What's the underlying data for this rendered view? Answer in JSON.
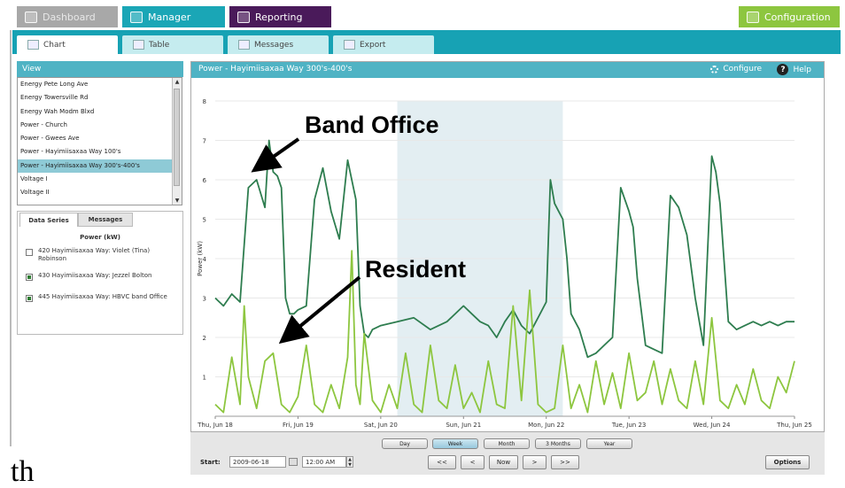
{
  "top_tabs": [
    {
      "label": "Dashboard",
      "icon": "dashboard-icon"
    },
    {
      "label": "Manager",
      "icon": "manager-icon"
    },
    {
      "label": "Reporting",
      "icon": "reporting-icon"
    },
    {
      "label": "Configuration",
      "icon": "configuration-icon"
    }
  ],
  "sub_tabs": [
    {
      "label": "Chart",
      "icon": "chart-icon",
      "active": true
    },
    {
      "label": "Table",
      "icon": "table-icon",
      "active": false
    },
    {
      "label": "Messages",
      "icon": "messages-icon",
      "active": false
    },
    {
      "label": "Export",
      "icon": "export-icon",
      "active": false
    }
  ],
  "view": {
    "header": "View",
    "items": [
      "Energy Pete Long Ave",
      "Energy Towersville Rd",
      "Energy Wah Modm Blxd",
      "Power - Church",
      "Power - Gwees Ave",
      "Power - Hayimiisaxaa Way 100's",
      "Power - Hayimiisaxaa Way 300's-400's",
      "Voltage I",
      "Voltage II"
    ],
    "selected_index": 6
  },
  "data_series_panel": {
    "tabs": [
      "Data Series",
      "Messages"
    ],
    "title": "Power (kW)",
    "series": [
      {
        "label": "420 Hayimiisaxaa Way: Violet (Tina) Robinson",
        "checked": false
      },
      {
        "label": "430 Hayimiisaxaa Way: Jezzel Bolton",
        "checked": true
      },
      {
        "label": "445 Hayimiisaxaa Way: HBVC band Office",
        "checked": true
      }
    ]
  },
  "chart_panel": {
    "title": "Power - Hayimiisaxaa Way 300's-400's",
    "configure_label": "Configure",
    "help_label": "Help"
  },
  "chart_data": {
    "type": "line",
    "ylabel": "Power (kW)",
    "ylim": [
      0,
      8
    ],
    "yticks": [
      1,
      2,
      3,
      4,
      5,
      6,
      7,
      8
    ],
    "xlim": [
      0,
      7
    ],
    "xticks": [
      {
        "x": 0,
        "label": "Thu, Jun 18"
      },
      {
        "x": 1,
        "label": "Fri, Jun 19"
      },
      {
        "x": 2,
        "label": "Sat, Jun 20"
      },
      {
        "x": 3,
        "label": "Sun, Jun 21"
      },
      {
        "x": 4,
        "label": "Mon, Jun 22"
      },
      {
        "x": 5,
        "label": "Tue, Jun 23"
      },
      {
        "x": 6,
        "label": "Wed, Jun 24"
      },
      {
        "x": 7,
        "label": "Thu, Jun 25"
      }
    ],
    "shaded_region": [
      2.2,
      4.2
    ],
    "grid": true,
    "series": [
      {
        "color": "#2e7d4f",
        "x": [
          0,
          0.1,
          0.2,
          0.3,
          0.4,
          0.5,
          0.6,
          0.65,
          0.7,
          0.75,
          0.8,
          0.85,
          0.9,
          0.95,
          1.0,
          1.1,
          1.2,
          1.3,
          1.4,
          1.5,
          1.6,
          1.7,
          1.75,
          1.8,
          1.85,
          1.9,
          2.0,
          2.2,
          2.4,
          2.6,
          2.8,
          3.0,
          3.1,
          3.2,
          3.3,
          3.4,
          3.5,
          3.6,
          3.7,
          3.8,
          3.9,
          4.0,
          4.05,
          4.1,
          4.15,
          4.2,
          4.25,
          4.3,
          4.4,
          4.5,
          4.6,
          4.7,
          4.8,
          4.9,
          5.0,
          5.05,
          5.1,
          5.2,
          5.3,
          5.4,
          5.5,
          5.6,
          5.7,
          5.8,
          5.9,
          6.0,
          6.05,
          6.1,
          6.2,
          6.3,
          6.4,
          6.5,
          6.6,
          6.7,
          6.8,
          6.9,
          7.0
        ],
        "values": [
          3.0,
          2.8,
          3.1,
          2.9,
          5.8,
          6.0,
          5.3,
          7.0,
          6.2,
          6.1,
          5.8,
          3.0,
          2.6,
          2.6,
          2.7,
          2.8,
          5.5,
          6.3,
          5.2,
          4.5,
          6.5,
          5.5,
          2.8,
          2.1,
          2.0,
          2.2,
          2.3,
          2.4,
          2.5,
          2.2,
          2.4,
          2.8,
          2.6,
          2.4,
          2.3,
          2.0,
          2.4,
          2.7,
          2.3,
          2.1,
          2.5,
          2.9,
          6.0,
          5.4,
          5.2,
          5.0,
          4.0,
          2.6,
          2.2,
          1.5,
          1.6,
          1.8,
          2.0,
          5.8,
          5.2,
          4.8,
          3.5,
          1.8,
          1.7,
          1.6,
          5.6,
          5.3,
          4.6,
          3.0,
          1.8,
          6.6,
          6.2,
          5.4,
          2.4,
          2.2,
          2.3,
          2.4,
          2.3,
          2.4,
          2.3,
          2.4,
          2.4
        ]
      },
      {
        "color": "#8dc63f",
        "x": [
          0,
          0.1,
          0.2,
          0.3,
          0.35,
          0.4,
          0.5,
          0.6,
          0.7,
          0.8,
          0.9,
          1.0,
          1.1,
          1.2,
          1.3,
          1.4,
          1.5,
          1.6,
          1.65,
          1.7,
          1.75,
          1.8,
          1.9,
          2.0,
          2.1,
          2.2,
          2.3,
          2.4,
          2.5,
          2.6,
          2.7,
          2.8,
          2.9,
          3.0,
          3.1,
          3.2,
          3.3,
          3.4,
          3.5,
          3.6,
          3.7,
          3.8,
          3.9,
          4.0,
          4.1,
          4.2,
          4.3,
          4.4,
          4.5,
          4.6,
          4.7,
          4.8,
          4.9,
          5.0,
          5.1,
          5.2,
          5.3,
          5.4,
          5.5,
          5.6,
          5.7,
          5.8,
          5.9,
          6.0,
          6.1,
          6.2,
          6.3,
          6.4,
          6.5,
          6.6,
          6.7,
          6.8,
          6.9,
          7.0
        ],
        "values": [
          0.3,
          0.1,
          1.5,
          0.3,
          2.8,
          1.0,
          0.2,
          1.4,
          1.6,
          0.3,
          0.1,
          0.5,
          1.8,
          0.3,
          0.1,
          0.8,
          0.2,
          1.5,
          4.2,
          0.8,
          0.3,
          2.1,
          0.4,
          0.1,
          0.8,
          0.2,
          1.6,
          0.3,
          0.1,
          1.8,
          0.4,
          0.2,
          1.3,
          0.2,
          0.6,
          0.1,
          1.4,
          0.3,
          0.2,
          2.8,
          0.4,
          3.2,
          0.3,
          0.1,
          0.2,
          1.8,
          0.2,
          0.8,
          0.1,
          1.4,
          0.3,
          1.1,
          0.2,
          1.6,
          0.4,
          0.6,
          1.4,
          0.3,
          1.2,
          0.4,
          0.2,
          1.4,
          0.3,
          2.5,
          0.4,
          0.2,
          0.8,
          0.3,
          1.2,
          0.4,
          0.2,
          1.0,
          0.6,
          1.4
        ]
      }
    ]
  },
  "controls": {
    "range_buttons": [
      "Day",
      "Week",
      "Month",
      "3 Months",
      "Year"
    ],
    "range_active": "Week",
    "start_label": "Start:",
    "start_date": "2009-06-18",
    "start_time": "12:00 AM",
    "nav_buttons": [
      "<<",
      "<",
      "Now",
      ">",
      ">>"
    ],
    "options_label": "Options"
  },
  "annotations": {
    "band_office": "Band Office",
    "resident": "Resident"
  },
  "bottom_text": "th"
}
